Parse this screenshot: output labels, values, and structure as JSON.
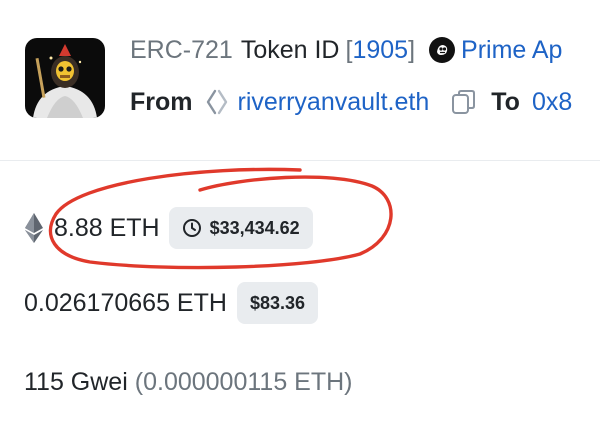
{
  "header": {
    "token_standard": "ERC-721",
    "token_id_label": "Token ID",
    "bracket_open": "[",
    "token_id": "1905",
    "bracket_close": "]",
    "collection_name": "Prime Ap",
    "from_label": "From",
    "from_address": "riverryanvault.eth",
    "to_label": "To",
    "to_address": "0x8"
  },
  "value": {
    "amount": "8.88 ETH",
    "usd": "$33,434.62"
  },
  "fee": {
    "amount": "0.026170665 ETH",
    "usd": "$83.36"
  },
  "gas": {
    "gwei": "115 Gwei",
    "eth": "(0.000000115 ETH)"
  },
  "colors": {
    "link": "#1e63c6",
    "muted": "#6c757d",
    "pill_bg": "#e9ecef",
    "annotation_red": "#e0392b"
  },
  "icons": {
    "nft": "ape-nft-thumbnail",
    "collection": "prime-ape-collection-icon",
    "ens": "ens-icon",
    "copy": "copy-icon",
    "eth": "ethereum-icon",
    "clock": "clock-icon"
  }
}
